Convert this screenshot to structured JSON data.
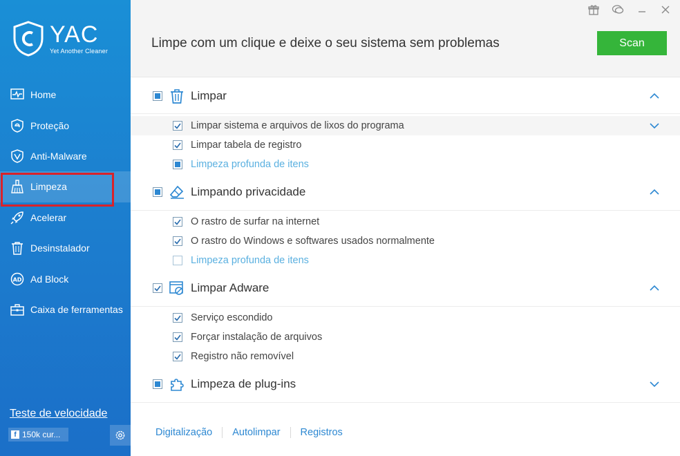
{
  "app": {
    "name": "YAC",
    "tagline": "Yet Another Cleaner"
  },
  "sidebar": {
    "items": [
      {
        "label": "Home",
        "icon": "pulse-monitor-icon"
      },
      {
        "label": "Proteção",
        "icon": "shield-e-icon"
      },
      {
        "label": "Anti-Malware",
        "icon": "shield-v-icon"
      },
      {
        "label": "Limpeza",
        "icon": "broom-icon",
        "active": true
      },
      {
        "label": "Acelerar",
        "icon": "rocket-icon"
      },
      {
        "label": "Desinstalador",
        "icon": "trash-icon"
      },
      {
        "label": "Ad Block",
        "icon": "adblock-icon"
      },
      {
        "label": "Caixa de ferramentas",
        "icon": "toolbox-icon"
      }
    ],
    "speed_test": "Teste de velocidade",
    "facebook": "150k cur...",
    "facebook_icon": "f"
  },
  "header": {
    "title": "Limpe com um clique e deixe o seu sistema sem problemas",
    "scan_label": "Scan"
  },
  "categories": [
    {
      "label": "Limpar",
      "state": "partial",
      "icon": "trash-icon",
      "expanded": true,
      "items": [
        {
          "label": "Limpar sistema e arquivos de lixos do programa",
          "state": "checked",
          "expandable": true
        },
        {
          "label": "Limpar tabela de registro",
          "state": "checked"
        },
        {
          "label": "Limpeza profunda de itens",
          "state": "partial",
          "link": true
        }
      ]
    },
    {
      "label": "Limpando privacidade",
      "state": "partial",
      "icon": "eraser-icon",
      "expanded": true,
      "items": [
        {
          "label": "O rastro de surfar na internet",
          "state": "checked"
        },
        {
          "label": "O rastro do Windows e softwares usados normalmente",
          "state": "checked"
        },
        {
          "label": "Limpeza profunda de itens",
          "state": "empty",
          "link": true
        }
      ]
    },
    {
      "label": "Limpar Adware",
      "state": "checked",
      "icon": "adware-window-icon",
      "expanded": true,
      "items": [
        {
          "label": "Serviço escondido",
          "state": "checked"
        },
        {
          "label": "Forçar instalação de arquivos",
          "state": "checked"
        },
        {
          "label": "Registro não removível",
          "state": "checked"
        }
      ]
    },
    {
      "label": "Limpeza de plug-ins",
      "state": "partial",
      "icon": "puzzle-icon",
      "expanded": false,
      "items": []
    }
  ],
  "footer": {
    "tabs": [
      "Digitalização",
      "Autolimpar",
      "Registros"
    ]
  },
  "colors": {
    "sidebar": "#1b7fcf",
    "scan": "#35b53a",
    "accent": "#2d88d2",
    "link": "#5ab0e0",
    "highlight": "#d9222a"
  }
}
